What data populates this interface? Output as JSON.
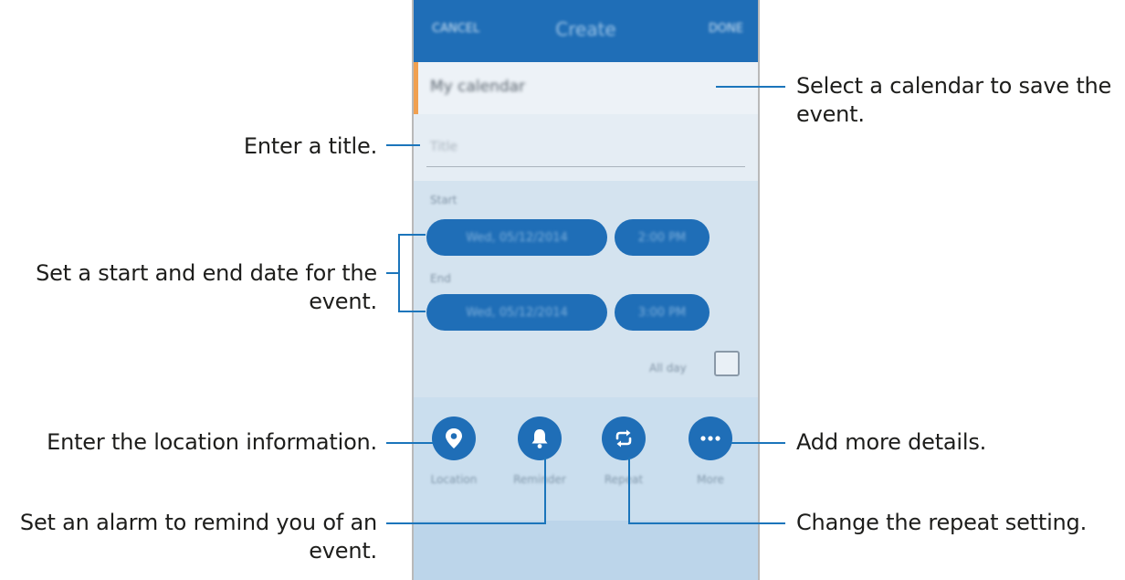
{
  "screen": {
    "cancel_label": "CANCEL",
    "title": "Create",
    "done_label": "DONE",
    "calendar_name": "My calendar",
    "title_placeholder": "Title",
    "start_label": "Start",
    "start_date": "Wed, 05/12/2014",
    "start_time": "2:00 PM",
    "end_label": "End",
    "end_date": "Wed, 05/12/2014",
    "end_time": "3:00 PM",
    "all_day_label": "All day",
    "all_day_checked": false,
    "actions": [
      {
        "label": "Location",
        "icon": "location-pin-icon"
      },
      {
        "label": "Reminder",
        "icon": "bell-icon"
      },
      {
        "label": "Repeat",
        "icon": "repeat-icon"
      },
      {
        "label": "More",
        "icon": "more-dots-icon"
      }
    ]
  },
  "annotations": {
    "calendar": "Select a calendar to save the event.",
    "title": "Enter a title.",
    "dates": "Set a start and end date for the event.",
    "location": "Enter the location information.",
    "more": "Add more details.",
    "reminder": "Set an alarm to remind you of an event.",
    "repeat": "Change the repeat setting."
  },
  "colors": {
    "primary": "#1f6eb7",
    "callout_line": "#1b75bb",
    "calendar_accent": "#f0a050"
  }
}
